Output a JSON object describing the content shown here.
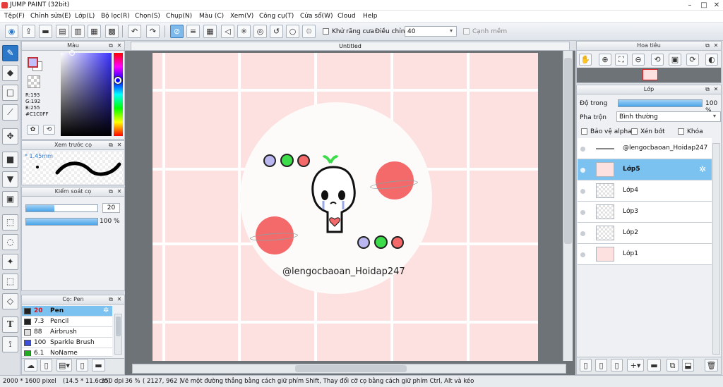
{
  "app": {
    "title": "JUMP PAINT (32bit)"
  },
  "menu": [
    "Tệp(F)",
    "Chỉnh sửa(E)",
    "Lớp(L)",
    "Bộ lọc(R)",
    "Chọn(S)",
    "Chụp(N)",
    "Màu (C)",
    "Xem(V)",
    "Công cụ(T)",
    "Cửa sổ(W)",
    "Cloud",
    "Help"
  ],
  "toolbar": {
    "antialias_label": "Khử răng cưa",
    "adjust_label": "Điều chỉnh",
    "adjust_value": "40",
    "snap_label": "Cạnh mềm"
  },
  "color_panel": {
    "title": "Màu",
    "r": "R:193",
    "g": "G:192",
    "b": "B:255",
    "hex": "#C1C0FF",
    "fg": "#c1c0ff",
    "bg": "#ffffff"
  },
  "brush_preview": {
    "title": "Xem trước cọ",
    "size": "1.45mm"
  },
  "brush_control": {
    "title": "Kiểm soát cọ",
    "size_value": "20",
    "opacity_value": "100 %",
    "size_frac": 0.4,
    "opacity_frac": 1.0
  },
  "brush_list": {
    "title": "Cọ: Pen",
    "items": [
      {
        "size": "20",
        "name": "Pen",
        "color": "#222222",
        "selected": true
      },
      {
        "size": "7.3",
        "name": "Pencil",
        "color": "#222222",
        "selected": false
      },
      {
        "size": "88",
        "name": "Airbrush",
        "color": "#dddddd",
        "selected": false
      },
      {
        "size": "100",
        "name": "Sparkle Brush",
        "color": "#3b4fd8",
        "selected": false
      },
      {
        "size": "6.1",
        "name": "NoName",
        "color": "#22aa22",
        "selected": false
      }
    ]
  },
  "canvas": {
    "tab": "Untitled",
    "watermark": "@lengocbaoan_Hoidap247"
  },
  "navigator": {
    "title": "Hoa tiêu"
  },
  "layer_panel": {
    "title": "Lớp",
    "opacity_label": "Độ trong",
    "opacity_value": "100 %",
    "blend_label": "Pha trộn",
    "blend_value": "Bình thường",
    "protect_alpha": "Bảo vệ alpha",
    "clip": "Xén bớt",
    "lock": "Khóa",
    "layers": [
      {
        "name": "@lengocbaoan_Hoidap247",
        "selected": false
      },
      {
        "name": "Lớp5",
        "selected": true
      },
      {
        "name": "Lớp4",
        "selected": false
      },
      {
        "name": "Lớp3",
        "selected": false
      },
      {
        "name": "Lớp2",
        "selected": false
      },
      {
        "name": "Lớp1",
        "selected": false
      }
    ]
  },
  "status": {
    "size": "2000 * 1600 pixel",
    "cm": "(14.5 * 11.6cm)",
    "dpi": "350 dpi",
    "zoom": "36 %",
    "coords": "( 2127, 962 )",
    "hint": "Vẽ một đường thẳng bằng cách giữ phím Shift, Thay đổi cỡ cọ bằng cách giữ phím Ctrl, Alt và kéo"
  }
}
